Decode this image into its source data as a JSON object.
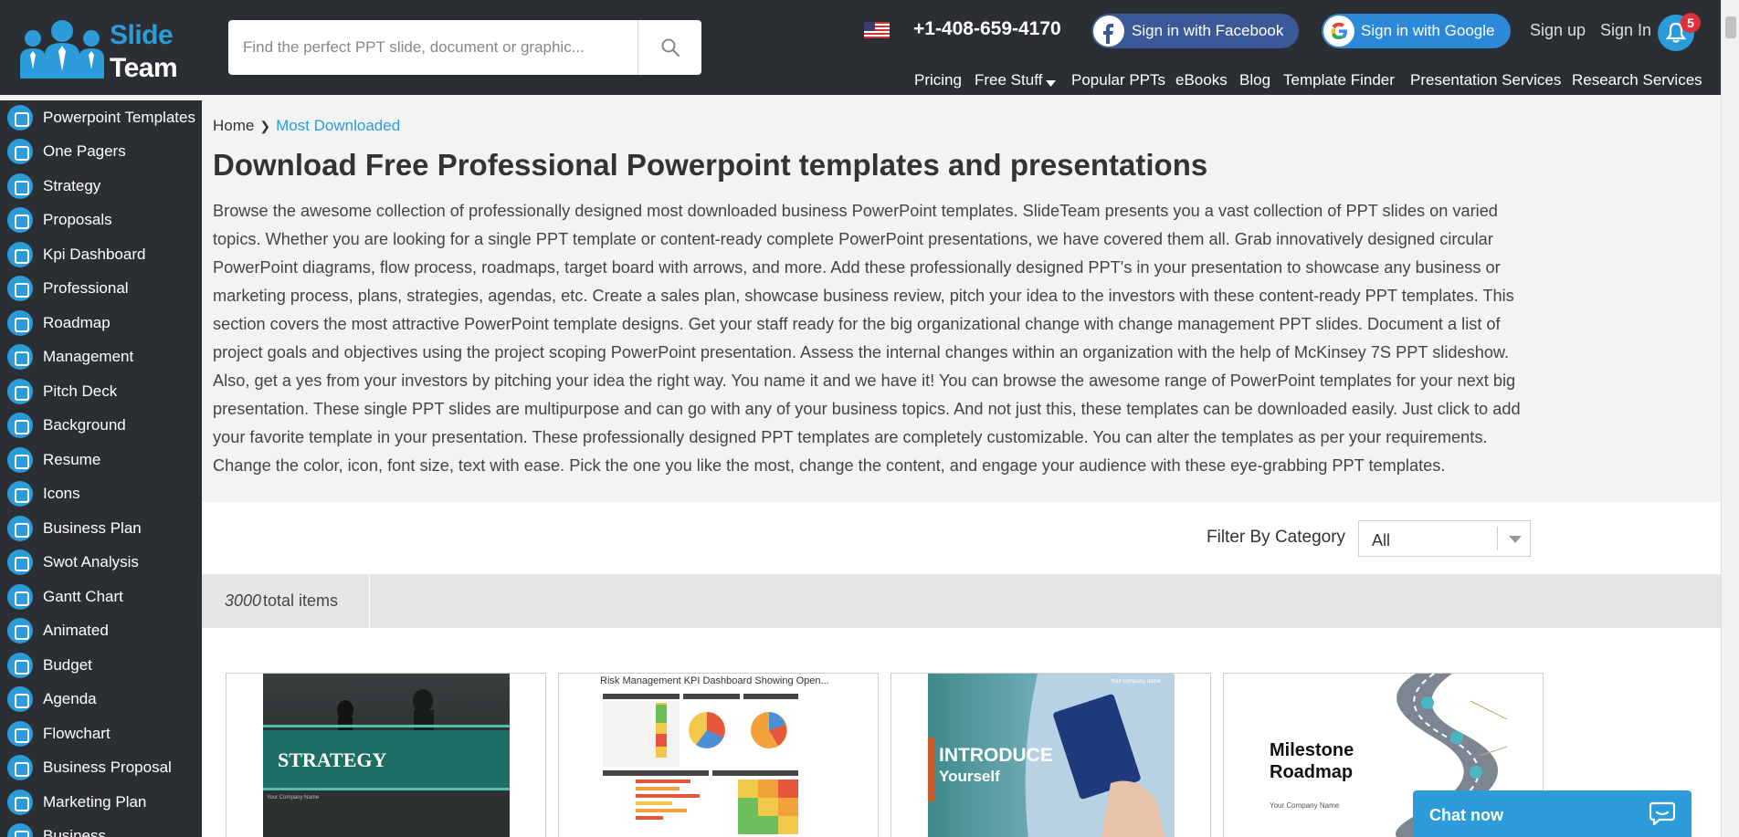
{
  "header": {
    "logo_line1": "Slide",
    "logo_line2": "Team",
    "search_placeholder": "Find the perfect PPT slide, document or graphic...",
    "phone": "+1-408-659-4170",
    "facebook_label": "Sign in with Facebook",
    "google_label": "Sign in with Google",
    "signup_label": "Sign up",
    "signin_label": "Sign In",
    "notification_count": "5",
    "nav": [
      "Pricing",
      "Free Stuff",
      "Popular PPTs",
      "eBooks",
      "Blog",
      "Template Finder",
      "Presentation Services",
      "Research Services"
    ]
  },
  "sidebar": {
    "items": [
      "Powerpoint Templates",
      "One Pagers",
      "Strategy",
      "Proposals",
      "Kpi Dashboard",
      "Professional",
      "Roadmap",
      "Management",
      "Pitch Deck",
      "Background",
      "Resume",
      "Icons",
      "Business Plan",
      "Swot Analysis",
      "Gantt Chart",
      "Animated",
      "Budget",
      "Agenda",
      "Flowchart",
      "Business Proposal",
      "Marketing Plan",
      "Business"
    ]
  },
  "breadcrumb": {
    "home": "Home",
    "current": "Most Downloaded"
  },
  "page_title": "Download Free Professional Powerpoint templates and presentations",
  "intro_text": "Browse the awesome collection of professionally designed most downloaded business PowerPoint templates. SlideTeam presents you a vast collection of PPT slides on varied topics. Whether you are looking for a single PPT template or content-ready complete PowerPoint presentations, we have covered them all. Grab innovatively designed circular PowerPoint diagrams, flow process, roadmaps, target board with arrows, and more. Add these professionally designed PPT's in your presentation to showcase any business or marketing process, plans, strategies, agendas, etc. Create a sales plan, showcase business review, pitch your idea to the investors with these content-ready PPT templates. This section covers the most attractive PowerPoint template designs. Get your staff ready for the big organizational change with change management PPT slides. Document a list of project goals and objectives using the project scoping PowerPoint presentation. Assess the internal changes within an organization with the help of McKinsey 7S PPT slideshow. Also, get a yes from your investors by pitching your idea the right way. You name it and we have it! You can browse the awesome range of PowerPoint templates for your next big presentation. These single PPT slides are multipurpose and can go with any of your business topics. And not just this, these templates can be downloaded easily. Just click to add your favorite template in your presentation. These professionally designed PPT templates are completely customizable. You can alter the templates as per your requirements. Change the color, icon, font size, text with ease. Pick the one you like the most, change the content, and engage your audience with these eye-grabbing PPT templates.",
  "filter": {
    "label": "Filter By Category",
    "selected": "All"
  },
  "total": {
    "count": "3000",
    "suffix": "total items"
  },
  "cards": [
    {
      "thumb_title": "STRATEGY",
      "thumb_sub": "Your Company Name"
    },
    {
      "thumb_title": "Risk Management KPI Dashboard Showing Open..."
    },
    {
      "thumb_title": "INTRODUCE",
      "thumb_sub": "Yourself",
      "thumb_corner": "Your company name"
    },
    {
      "thumb_title": "Milestone",
      "thumb_title2": "Roadmap",
      "thumb_sub": "Your Company Name"
    }
  ],
  "chat": {
    "label": "Chat now"
  },
  "colors": {
    "accent": "#2c9bd9",
    "header_bg": "#2b2f33",
    "facebook": "#3b5998",
    "badge": "#e0303a"
  }
}
